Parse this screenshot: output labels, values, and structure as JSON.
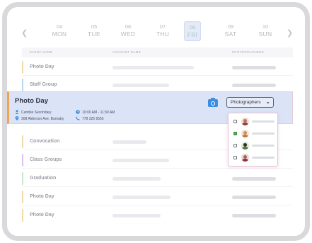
{
  "week": {
    "days": [
      {
        "num": "04",
        "name": "MON"
      },
      {
        "num": "05",
        "name": "TUE"
      },
      {
        "num": "06",
        "name": "WED"
      },
      {
        "num": "07",
        "name": "THU"
      },
      {
        "num": "08",
        "name": "FRI",
        "selected": true
      },
      {
        "num": "09",
        "name": "SAT"
      },
      {
        "num": "10",
        "name": "SUN"
      }
    ],
    "prev_icon": "chevron-left-icon",
    "next_icon": "chevron-right-icon"
  },
  "table": {
    "headers": {
      "event": "EVENT NAME",
      "account": "ACCOUNT NAME",
      "photographers": "PHOTOGRAPHERS"
    },
    "rows_before": [
      {
        "title": "Photo Day",
        "color": "#f5d9a8"
      },
      {
        "title": "Staff Group",
        "color": "#bcd6f2"
      }
    ],
    "rows_after": [
      {
        "title": "Convocation",
        "color": "#f5d9a8"
      },
      {
        "title": "Class Groups",
        "color": "#d9c4ef"
      },
      {
        "title": "Graduation",
        "color": "#c7e8c9"
      },
      {
        "title": "Photo Day",
        "color": "#f5d9a8"
      },
      {
        "title": "Photo Day",
        "color": "#f5d9a8"
      }
    ]
  },
  "selected_event": {
    "title": "Photo Day",
    "account": "Cambie Secondary",
    "address": "308 Alderson Ave, Burnaby",
    "time": "10:00 AM - 11:30 AM",
    "phone": "778 325 6555",
    "accent_color": "#f0a25a",
    "camera_icon": "camera-icon",
    "dropdown_label": "Photographers",
    "photographers": [
      {
        "checked": false
      },
      {
        "checked": true
      },
      {
        "checked": false
      },
      {
        "checked": false
      }
    ]
  }
}
